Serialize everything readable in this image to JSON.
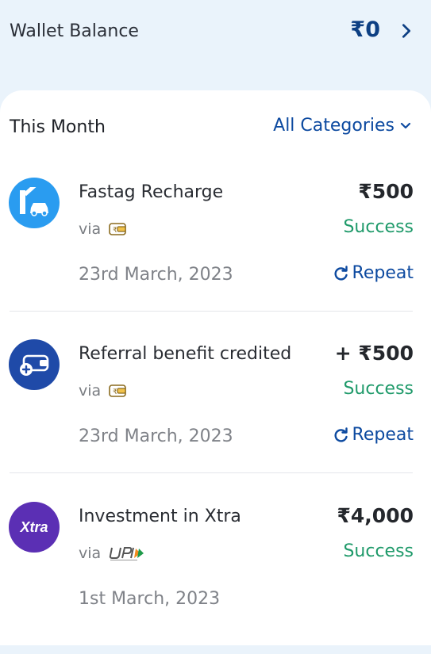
{
  "wallet": {
    "label": "Wallet Balance",
    "amount": "₹0"
  },
  "filter": {
    "period": "This Month",
    "category": "All Categories"
  },
  "transactions": [
    {
      "title": "Fastag Recharge",
      "amount": "₹500",
      "via_label": "via",
      "via_method": "wallet-icon",
      "status": "Success",
      "date": "23rd March, 2023",
      "action": "Repeat",
      "icon": "fastag-toll-icon",
      "icon_color": "#2a9cf0"
    },
    {
      "title": "Referral benefit credited",
      "amount": "+ ₹500",
      "via_label": "via",
      "via_method": "wallet-icon",
      "status": "Success",
      "date": "23rd March, 2023",
      "action": "Repeat",
      "icon": "referral-wallet-icon",
      "icon_color": "#1f4aa8"
    },
    {
      "title": "Investment in Xtra",
      "amount": "₹4,000",
      "via_label": "via",
      "via_method": "upi-logo",
      "status": "Success",
      "date": "1st March, 2023",
      "icon": "xtra-logo",
      "icon_text": "Xtra",
      "icon_color": "#5b2fb4"
    }
  ],
  "colors": {
    "accent": "#0d4aa0",
    "success": "#1f9a6a",
    "background": "#eaf3fb"
  }
}
